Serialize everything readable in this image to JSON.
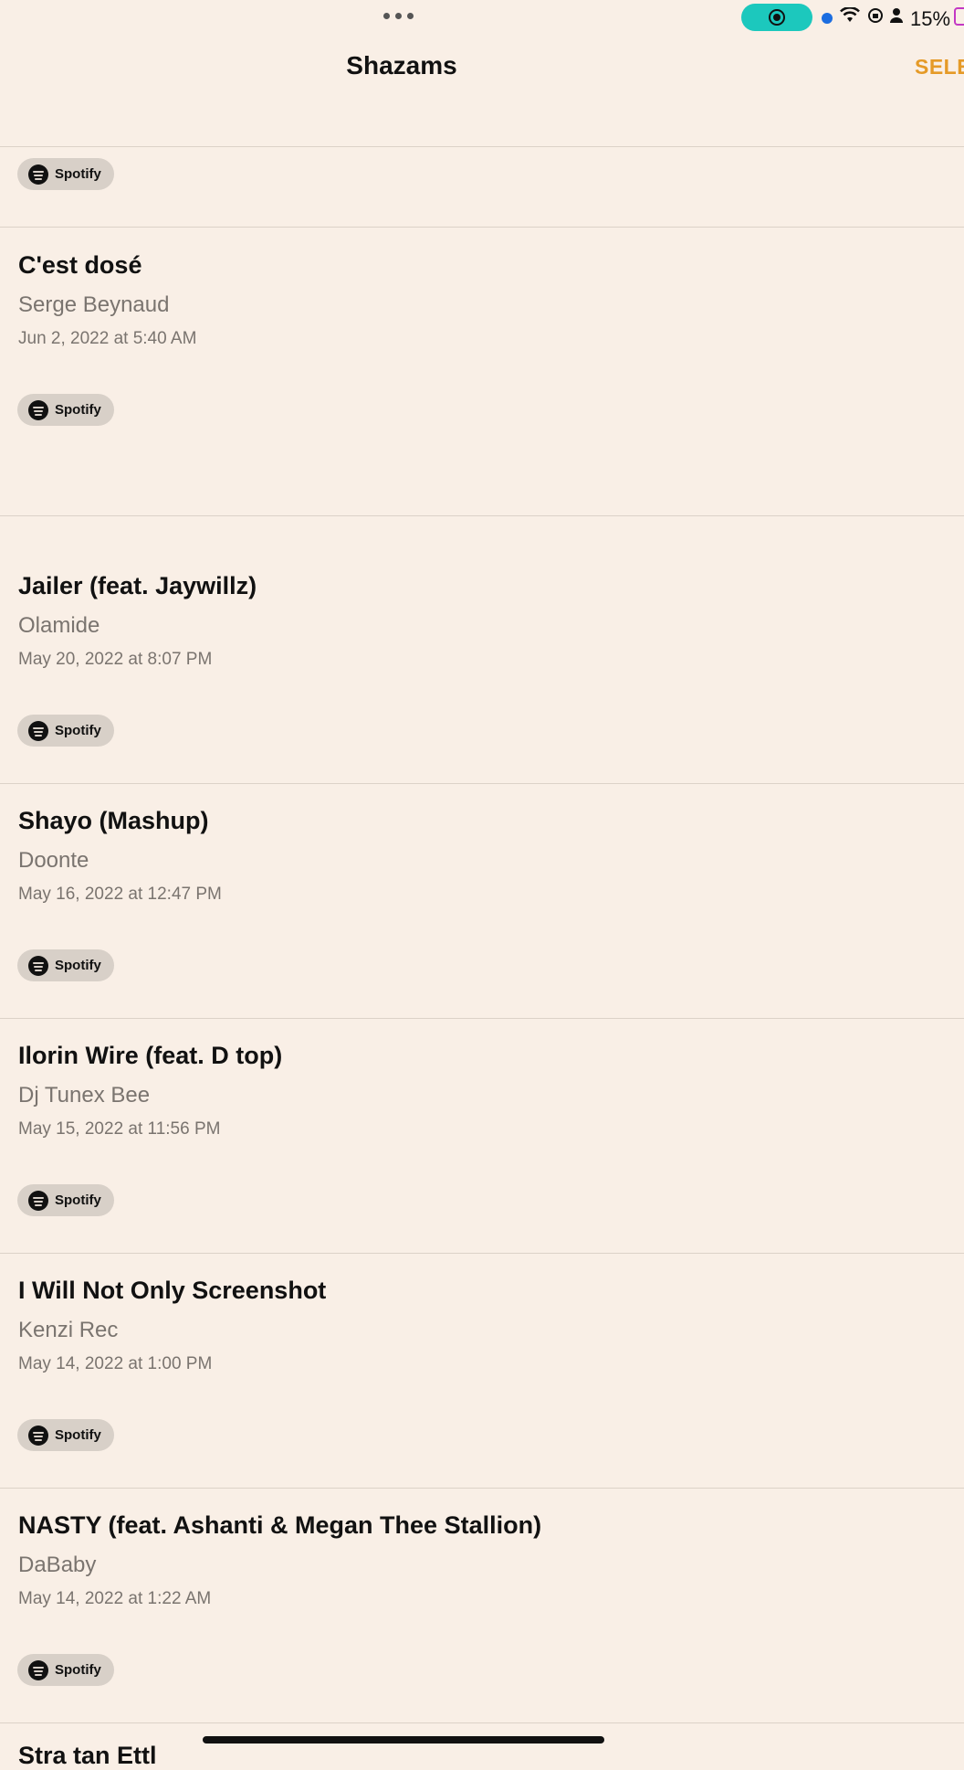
{
  "status_bar": {
    "battery_text": "15%",
    "icons": [
      "more-dots-icon",
      "screen-record-icon",
      "location-dot-icon",
      "wifi-icon",
      "orientation-lock-icon",
      "person-icon",
      "battery-icon"
    ],
    "accent_colors": {
      "record_pill": "#1cc8bd",
      "location_dot": "#1c6de0",
      "battery": "#c338c4"
    }
  },
  "nav": {
    "title": "Shazams",
    "select_label": "SELE",
    "select_color": "#e59a27"
  },
  "spotify_label": "Spotify",
  "items": [
    {
      "title": "C'est dosé",
      "artist": "Serge Beynaud",
      "date": "Jun 2, 2022 at 5:40 AM"
    },
    {
      "title": "Jailer (feat. Jaywillz)",
      "artist": "Olamide",
      "date": "May 20, 2022 at 8:07 PM"
    },
    {
      "title": "Shayo (Mashup)",
      "artist": "Doonte",
      "date": "May 16, 2022 at 12:47 PM"
    },
    {
      "title": "Ilorin Wire (feat. D top)",
      "artist": "Dj Tunex Bee",
      "date": "May 15, 2022 at 11:56 PM"
    },
    {
      "title": "I Will Not Only Screenshot",
      "artist": "Kenzi Rec",
      "date": "May 14, 2022 at 1:00 PM"
    },
    {
      "title": "NASTY (feat. Ashanti & Megan Thee Stallion)",
      "artist": "DaBaby",
      "date": "May 14, 2022 at 1:22 AM"
    }
  ],
  "partial_title": "Stra tan Ettl"
}
